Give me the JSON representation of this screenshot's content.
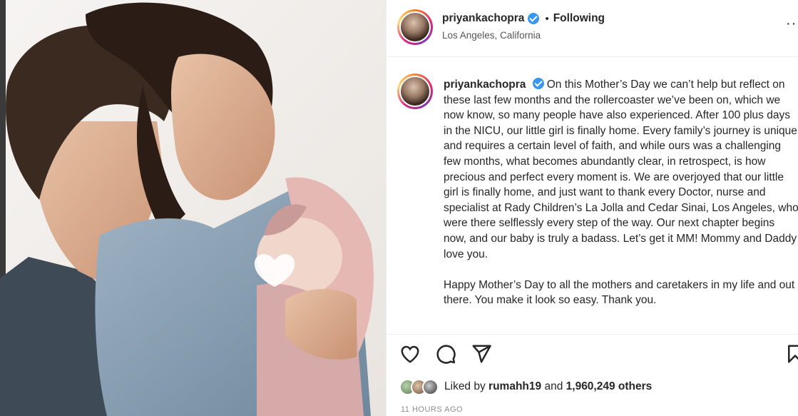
{
  "post": {
    "username": "priyankachopra",
    "following_label": "Following",
    "separator": "•",
    "location": "Los Angeles, California",
    "more_glyph": "···",
    "caption_username": "priyankachopra",
    "caption": "On this Mother’s Day we can’t help but reflect on these last few months and the rollercoaster we’ve been on, which we now know, so many people have also experienced. After 100 plus days in the NICU, our little girl is finally home. Every family’s journey is unique and requires a certain level of faith, and while ours was a challenging few months, what becomes abundantly clear, in retrospect, is how precious and perfect every moment is. We are overjoyed that our little girl is finally home, and just want to thank every Doctor, nurse and specialist at Rady Children’s La Jolla and Cedar Sinai, Los Angeles, who were there selflessly every step of the way. Our next chapter begins now, and our baby is truly a badass. Let’s get it MM! Mommy and Daddy love you.\n\nHappy Mother’s Day to all the mothers and caretakers in my life and out there. You make it look so easy. Thank you.",
    "likes": {
      "prefix": "Liked by",
      "user": "rumahh19",
      "conjunction": "and",
      "count": "1,960,249 others"
    },
    "timestamp": "11 HOURS AGO"
  },
  "icons": {
    "like": "heart-icon",
    "comment": "comment-icon",
    "share": "send-icon",
    "save": "bookmark-icon",
    "verified": "verified-badge-icon",
    "options": "more-options-icon"
  },
  "colors": {
    "verified_blue": "#3897f0",
    "text": "#262626",
    "muted": "#8e8e8e",
    "border": "#efefef"
  }
}
